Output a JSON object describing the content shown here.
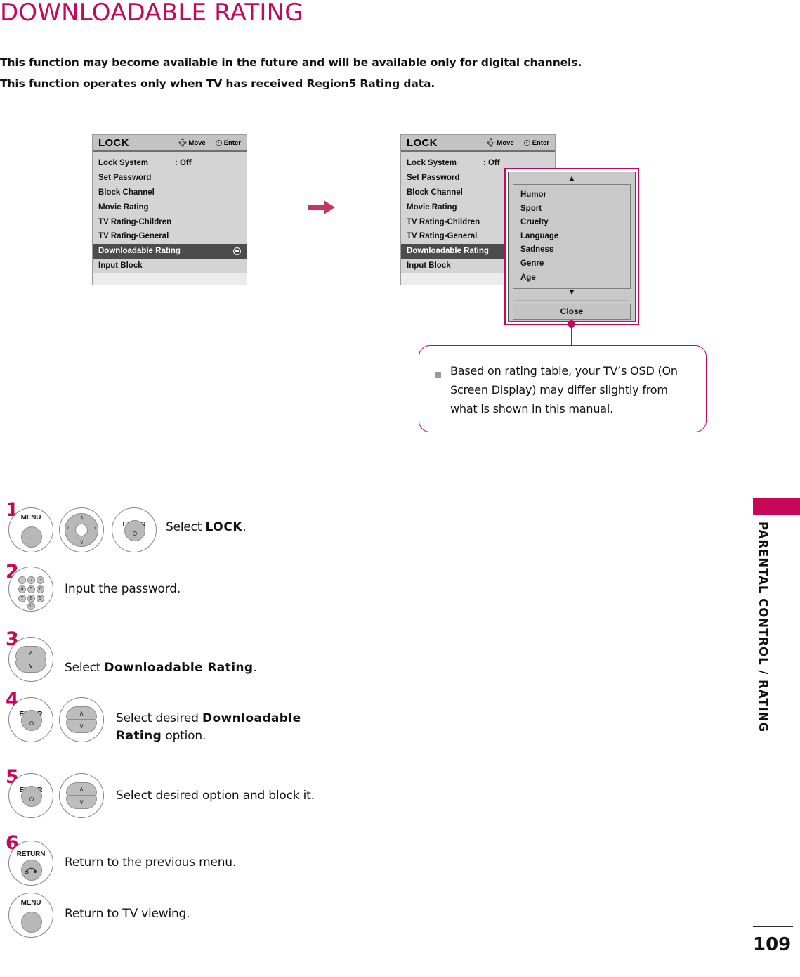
{
  "page": {
    "title": "DOWNLOADABLE RATING",
    "intro_line_1": "This function may become available in the future and will be available only for digital channels.",
    "intro_line_2": "This function operates only when TV has received Region5 Rating data.",
    "side_tab_label": "PARENTAL CONTROL / RATING",
    "page_number": "109",
    "accent_color": "#c7075a"
  },
  "menu_left": {
    "title": "LOCK",
    "hint_move": "Move",
    "hint_enter": "Enter",
    "rows": [
      {
        "label": "Lock System",
        "value": ": Off",
        "selected": false
      },
      {
        "label": "Set Password",
        "value": "",
        "selected": false
      },
      {
        "label": "Block Channel",
        "value": "",
        "selected": false
      },
      {
        "label": "Movie Rating",
        "value": "",
        "selected": false
      },
      {
        "label": "TV Rating-Children",
        "value": "",
        "selected": false
      },
      {
        "label": "TV Rating-General",
        "value": "",
        "selected": false
      },
      {
        "label": "Downloadable Rating",
        "value": "",
        "selected": true
      },
      {
        "label": "Input Block",
        "value": "",
        "selected": false
      }
    ]
  },
  "menu_right": {
    "title": "LOCK",
    "hint_move": "Move",
    "hint_enter": "Enter",
    "rows": [
      {
        "label": "Lock System",
        "value": ": Off",
        "selected": false
      },
      {
        "label": "Set Password",
        "value": "",
        "selected": false
      },
      {
        "label": "Block Channel",
        "value": "",
        "selected": false
      },
      {
        "label": "Movie Rating",
        "value": "",
        "selected": false
      },
      {
        "label": "TV Rating-Children",
        "value": "",
        "selected": false
      },
      {
        "label": "TV Rating-General",
        "value": "",
        "selected": false
      },
      {
        "label": "Downloadable Rating",
        "value": "",
        "selected": true
      },
      {
        "label": "Input Block",
        "value": "",
        "selected": false
      }
    ]
  },
  "popup": {
    "scroll_up": "▲",
    "scroll_down": "▼",
    "items": [
      "Humor",
      "Sport",
      "Cruelty",
      "Language",
      "Sadness",
      "Genre",
      "Age"
    ],
    "close_label": "Close"
  },
  "callout": {
    "text": "Based on rating table, your TV’s OSD (On Screen Display) may differ slightly from what is shown in this manual."
  },
  "steps": [
    {
      "num": "1",
      "buttons": [
        "MENU",
        "nav-wheel",
        "ENTER"
      ],
      "text_before": "Select ",
      "text_bold": "LOCK",
      "text_after": "."
    },
    {
      "num": "2",
      "buttons": [
        "number-keypad"
      ],
      "text_before": "Input the password.",
      "text_bold": "",
      "text_after": ""
    },
    {
      "num": "3",
      "buttons": [
        "up-down-rocker"
      ],
      "text_before": "Select ",
      "text_bold": "Downloadable Rating",
      "text_after": "."
    },
    {
      "num": "4",
      "buttons": [
        "ENTER",
        "up-down-rocker"
      ],
      "text_before": "Select desired ",
      "text_bold": "Downloadable Rating",
      "text_after": " option."
    },
    {
      "num": "5",
      "buttons": [
        "ENTER",
        "up-down-rocker"
      ],
      "text_before": "Select desired option and block it.",
      "text_bold": "",
      "text_after": ""
    },
    {
      "num": "6",
      "buttons": [
        "RETURN"
      ],
      "text_before": "Return to the previous menu.",
      "text_bold": "",
      "text_after": ""
    },
    {
      "num": "",
      "buttons": [
        "MENU"
      ],
      "text_before": "Return to TV viewing.",
      "text_bold": "",
      "text_after": ""
    }
  ],
  "button_labels": {
    "menu": "MENU",
    "enter": "ENTER",
    "return": "RETURN",
    "keypad_digits": [
      "1",
      "2",
      "3",
      "4",
      "5",
      "6",
      "7",
      "8",
      "9",
      "0"
    ],
    "chev_up": "∧",
    "chev_down": "∨",
    "chev_left": "‹",
    "chev_right": "›"
  }
}
